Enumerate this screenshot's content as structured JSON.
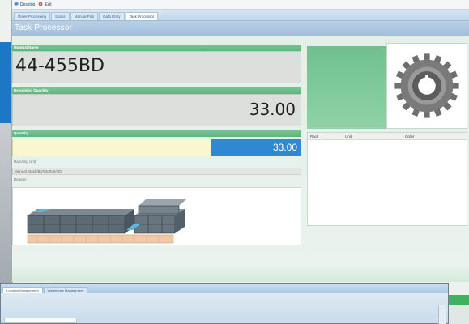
{
  "menu": {
    "items": [
      {
        "label": "Desktop",
        "icon": "desktop-icon"
      },
      {
        "label": "Exit",
        "icon": "exit-icon"
      }
    ]
  },
  "tabs": [
    {
      "label": "Order Processing",
      "active": false
    },
    {
      "label": "Status",
      "active": false
    },
    {
      "label": "Manual Pick",
      "active": false
    },
    {
      "label": "Data Entry",
      "active": false
    },
    {
      "label": "Task Processor",
      "active": true
    }
  ],
  "page_title": "Task Processor",
  "fields": {
    "material_name_label": "Material Name",
    "material_name_value": "44-455BD",
    "remaining_quantity_label": "Remaining Quantity",
    "remaining_quantity_value": "33.00",
    "quantity_label": "Quantity",
    "quantity_value": "33.00",
    "handling_unit_label": "Handling Unit",
    "handling_unit_value": "Manual Stock/BD/Storbin/4/0",
    "reason_label": "Reason"
  },
  "list": {
    "columns": [
      "Rack",
      "Unit",
      "Order"
    ]
  },
  "window2": {
    "tabs": [
      {
        "label": "Location Management",
        "active": true
      },
      {
        "label": "Warehouse Management",
        "active": false
      }
    ]
  },
  "colors": {
    "accent_blue": "#2f89d2",
    "label_green": "#5eb57e",
    "quantity_yellow": "#faf6d0"
  }
}
